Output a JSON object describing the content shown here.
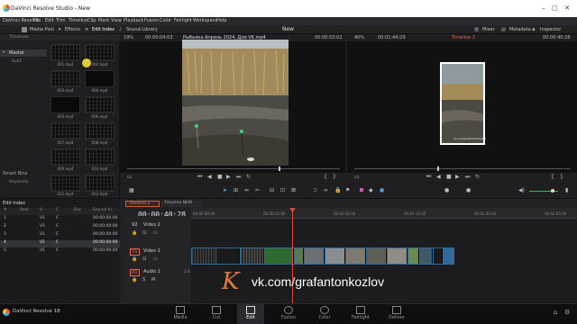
{
  "window": {
    "title": "DaVinci Resolve Studio - New"
  },
  "menu": [
    "DaVinci Resolve",
    "File",
    "Edit",
    "Trim",
    "Timeline",
    "Clip",
    "Mark",
    "View",
    "Playback",
    "Fusion",
    "Color",
    "Fairlight",
    "Workspace",
    "Help"
  ],
  "toolbar": {
    "media_pool": "Media Pool",
    "effects": "Effects",
    "edit_index": "Edit Index",
    "sound_library": "Sound Library",
    "project_name": "New",
    "mixer": "Mixer",
    "metadata": "Metadata",
    "inspector": "Inspector"
  },
  "bins": {
    "header": "Timelines",
    "master": "Master",
    "subclip": "SubC",
    "smart_bins": "Smart Bins",
    "keywords": "Keywords"
  },
  "media_pool": {
    "clips": [
      "001.mp4",
      "002.mp4",
      "003.mp4",
      "004.mp4",
      "005.mp4",
      "006.mp4",
      "007.mp4",
      "008.mp4",
      "009.mp4",
      "010.mp4",
      "011.mp4",
      "012.mp4"
    ]
  },
  "source_viewer": {
    "zoom": "19%",
    "timecode_in": "00:00:04:03",
    "clip_title": "Рыбалка Апрель 2024, Для VK.mp4",
    "timecode_out": "00:00:53:02"
  },
  "record_viewer": {
    "zoom": "40%",
    "timecode_in": "00:01:44:29",
    "timeline_name": "Timeline 2",
    "timecode_out": "00:00:40:28",
    "watermark": "vk.com/grafantonkozlov"
  },
  "edit_index": {
    "title": "Edit Index",
    "columns": [
      "#",
      "Reel",
      "V",
      "C",
      "Dur",
      "Source In"
    ],
    "rows": [
      {
        "n": "1",
        "reel": "",
        "v": "V1",
        "c": "C",
        "dur": "",
        "src": "00:00:00:00"
      },
      {
        "n": "2",
        "reel": "",
        "v": "V1",
        "c": "C",
        "dur": "",
        "src": "00:00:00:00"
      },
      {
        "n": "3",
        "reel": "",
        "v": "V1",
        "c": "C",
        "dur": "",
        "src": "00:00:00:00"
      },
      {
        "n": "4",
        "reel": "",
        "v": "V1",
        "c": "C",
        "dur": "",
        "src": "00:00:00:00"
      },
      {
        "n": "5",
        "reel": "",
        "v": "V1",
        "c": "C",
        "dur": "",
        "src": "00:00:00:00"
      }
    ]
  },
  "timeline": {
    "tabs": [
      "Timeline 2",
      "Timeline NEW"
    ],
    "timecode": "00:00:40:28",
    "ruler": [
      "00:00:00:00",
      "00:00:25:00",
      "00:00:50:00",
      "00:01:15:00",
      "00:01:40:00",
      "00:02:05:00"
    ],
    "tracks": {
      "v2": "V2",
      "v2_name": "Video 2",
      "v1": "V1",
      "v1_name": "Video 1",
      "a1": "A1",
      "a1_name": "Audio 1",
      "a1_level": "2.0"
    },
    "playhead_fraction": 0.24
  },
  "overlay": {
    "text": "vk.com/grafantonkozlov",
    "logo": "K"
  },
  "footer": {
    "app": "DaVinci Resolve 18",
    "pages": [
      "Media",
      "Cut",
      "Edit",
      "Fusion",
      "Color",
      "Fairlight",
      "Deliver"
    ],
    "active_page": "Edit"
  },
  "colors": {
    "playhead": "#e0453a",
    "timeline_tab": "#d35a3a",
    "clip_blue": "#2f6b9a"
  }
}
